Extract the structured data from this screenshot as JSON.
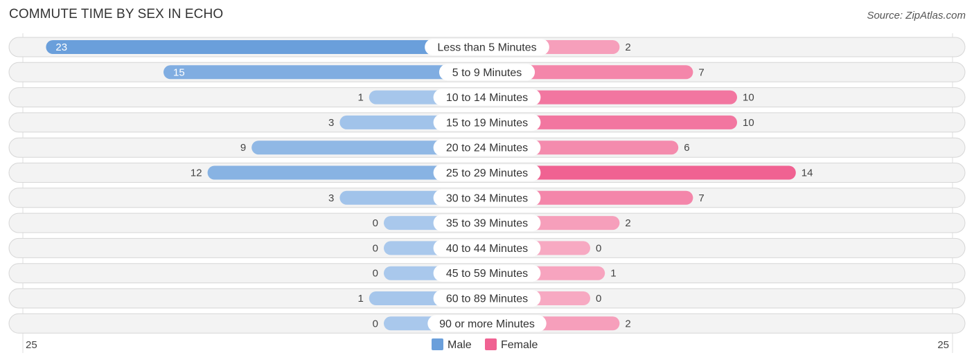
{
  "title": "COMMUTE TIME BY SEX IN ECHO",
  "source": "Source: ZipAtlas.com",
  "chart_data": {
    "type": "bar",
    "orientation": "horizontal-diverging",
    "title": "COMMUTE TIME BY SEX IN ECHO",
    "categories": [
      "Less than 5 Minutes",
      "5 to 9 Minutes",
      "10 to 14 Minutes",
      "15 to 19 Minutes",
      "20 to 24 Minutes",
      "25 to 29 Minutes",
      "30 to 34 Minutes",
      "35 to 39 Minutes",
      "40 to 44 Minutes",
      "45 to 59 Minutes",
      "60 to 89 Minutes",
      "90 or more Minutes"
    ],
    "series": [
      {
        "name": "Male",
        "color": "#6a9fdb",
        "values": [
          23,
          15,
          1,
          3,
          9,
          12,
          3,
          0,
          0,
          0,
          1,
          0
        ]
      },
      {
        "name": "Female",
        "color": "#f06292",
        "values": [
          2,
          7,
          10,
          10,
          6,
          14,
          7,
          2,
          0,
          1,
          0,
          2
        ]
      }
    ],
    "axis": {
      "left_label": "25",
      "right_label": "25",
      "max": 25
    },
    "legend": {
      "position": "bottom-center",
      "items": [
        "Male",
        "Female"
      ]
    },
    "grid": false
  }
}
